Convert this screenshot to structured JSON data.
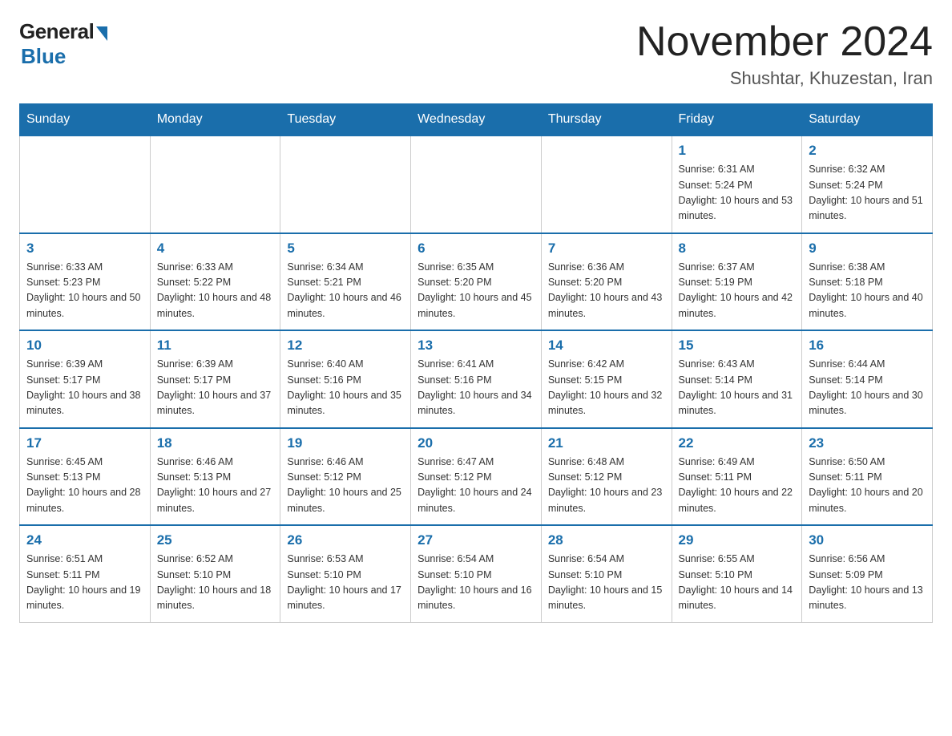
{
  "logo": {
    "general_text": "General",
    "blue_text": "Blue"
  },
  "title": {
    "month_year": "November 2024",
    "location": "Shushtar, Khuzestan, Iran"
  },
  "days_of_week": [
    "Sunday",
    "Monday",
    "Tuesday",
    "Wednesday",
    "Thursday",
    "Friday",
    "Saturday"
  ],
  "weeks": [
    [
      {
        "day": "",
        "sunrise": "",
        "sunset": "",
        "daylight": ""
      },
      {
        "day": "",
        "sunrise": "",
        "sunset": "",
        "daylight": ""
      },
      {
        "day": "",
        "sunrise": "",
        "sunset": "",
        "daylight": ""
      },
      {
        "day": "",
        "sunrise": "",
        "sunset": "",
        "daylight": ""
      },
      {
        "day": "",
        "sunrise": "",
        "sunset": "",
        "daylight": ""
      },
      {
        "day": "1",
        "sunrise": "Sunrise: 6:31 AM",
        "sunset": "Sunset: 5:24 PM",
        "daylight": "Daylight: 10 hours and 53 minutes."
      },
      {
        "day": "2",
        "sunrise": "Sunrise: 6:32 AM",
        "sunset": "Sunset: 5:24 PM",
        "daylight": "Daylight: 10 hours and 51 minutes."
      }
    ],
    [
      {
        "day": "3",
        "sunrise": "Sunrise: 6:33 AM",
        "sunset": "Sunset: 5:23 PM",
        "daylight": "Daylight: 10 hours and 50 minutes."
      },
      {
        "day": "4",
        "sunrise": "Sunrise: 6:33 AM",
        "sunset": "Sunset: 5:22 PM",
        "daylight": "Daylight: 10 hours and 48 minutes."
      },
      {
        "day": "5",
        "sunrise": "Sunrise: 6:34 AM",
        "sunset": "Sunset: 5:21 PM",
        "daylight": "Daylight: 10 hours and 46 minutes."
      },
      {
        "day": "6",
        "sunrise": "Sunrise: 6:35 AM",
        "sunset": "Sunset: 5:20 PM",
        "daylight": "Daylight: 10 hours and 45 minutes."
      },
      {
        "day": "7",
        "sunrise": "Sunrise: 6:36 AM",
        "sunset": "Sunset: 5:20 PM",
        "daylight": "Daylight: 10 hours and 43 minutes."
      },
      {
        "day": "8",
        "sunrise": "Sunrise: 6:37 AM",
        "sunset": "Sunset: 5:19 PM",
        "daylight": "Daylight: 10 hours and 42 minutes."
      },
      {
        "day": "9",
        "sunrise": "Sunrise: 6:38 AM",
        "sunset": "Sunset: 5:18 PM",
        "daylight": "Daylight: 10 hours and 40 minutes."
      }
    ],
    [
      {
        "day": "10",
        "sunrise": "Sunrise: 6:39 AM",
        "sunset": "Sunset: 5:17 PM",
        "daylight": "Daylight: 10 hours and 38 minutes."
      },
      {
        "day": "11",
        "sunrise": "Sunrise: 6:39 AM",
        "sunset": "Sunset: 5:17 PM",
        "daylight": "Daylight: 10 hours and 37 minutes."
      },
      {
        "day": "12",
        "sunrise": "Sunrise: 6:40 AM",
        "sunset": "Sunset: 5:16 PM",
        "daylight": "Daylight: 10 hours and 35 minutes."
      },
      {
        "day": "13",
        "sunrise": "Sunrise: 6:41 AM",
        "sunset": "Sunset: 5:16 PM",
        "daylight": "Daylight: 10 hours and 34 minutes."
      },
      {
        "day": "14",
        "sunrise": "Sunrise: 6:42 AM",
        "sunset": "Sunset: 5:15 PM",
        "daylight": "Daylight: 10 hours and 32 minutes."
      },
      {
        "day": "15",
        "sunrise": "Sunrise: 6:43 AM",
        "sunset": "Sunset: 5:14 PM",
        "daylight": "Daylight: 10 hours and 31 minutes."
      },
      {
        "day": "16",
        "sunrise": "Sunrise: 6:44 AM",
        "sunset": "Sunset: 5:14 PM",
        "daylight": "Daylight: 10 hours and 30 minutes."
      }
    ],
    [
      {
        "day": "17",
        "sunrise": "Sunrise: 6:45 AM",
        "sunset": "Sunset: 5:13 PM",
        "daylight": "Daylight: 10 hours and 28 minutes."
      },
      {
        "day": "18",
        "sunrise": "Sunrise: 6:46 AM",
        "sunset": "Sunset: 5:13 PM",
        "daylight": "Daylight: 10 hours and 27 minutes."
      },
      {
        "day": "19",
        "sunrise": "Sunrise: 6:46 AM",
        "sunset": "Sunset: 5:12 PM",
        "daylight": "Daylight: 10 hours and 25 minutes."
      },
      {
        "day": "20",
        "sunrise": "Sunrise: 6:47 AM",
        "sunset": "Sunset: 5:12 PM",
        "daylight": "Daylight: 10 hours and 24 minutes."
      },
      {
        "day": "21",
        "sunrise": "Sunrise: 6:48 AM",
        "sunset": "Sunset: 5:12 PM",
        "daylight": "Daylight: 10 hours and 23 minutes."
      },
      {
        "day": "22",
        "sunrise": "Sunrise: 6:49 AM",
        "sunset": "Sunset: 5:11 PM",
        "daylight": "Daylight: 10 hours and 22 minutes."
      },
      {
        "day": "23",
        "sunrise": "Sunrise: 6:50 AM",
        "sunset": "Sunset: 5:11 PM",
        "daylight": "Daylight: 10 hours and 20 minutes."
      }
    ],
    [
      {
        "day": "24",
        "sunrise": "Sunrise: 6:51 AM",
        "sunset": "Sunset: 5:11 PM",
        "daylight": "Daylight: 10 hours and 19 minutes."
      },
      {
        "day": "25",
        "sunrise": "Sunrise: 6:52 AM",
        "sunset": "Sunset: 5:10 PM",
        "daylight": "Daylight: 10 hours and 18 minutes."
      },
      {
        "day": "26",
        "sunrise": "Sunrise: 6:53 AM",
        "sunset": "Sunset: 5:10 PM",
        "daylight": "Daylight: 10 hours and 17 minutes."
      },
      {
        "day": "27",
        "sunrise": "Sunrise: 6:54 AM",
        "sunset": "Sunset: 5:10 PM",
        "daylight": "Daylight: 10 hours and 16 minutes."
      },
      {
        "day": "28",
        "sunrise": "Sunrise: 6:54 AM",
        "sunset": "Sunset: 5:10 PM",
        "daylight": "Daylight: 10 hours and 15 minutes."
      },
      {
        "day": "29",
        "sunrise": "Sunrise: 6:55 AM",
        "sunset": "Sunset: 5:10 PM",
        "daylight": "Daylight: 10 hours and 14 minutes."
      },
      {
        "day": "30",
        "sunrise": "Sunrise: 6:56 AM",
        "sunset": "Sunset: 5:09 PM",
        "daylight": "Daylight: 10 hours and 13 minutes."
      }
    ]
  ]
}
